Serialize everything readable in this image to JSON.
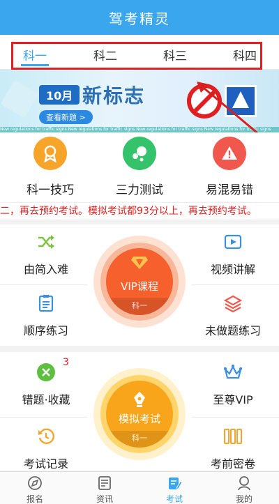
{
  "app": {
    "title": "驾考精灵"
  },
  "tabs": [
    {
      "label": "科一",
      "active": true
    },
    {
      "label": "科二",
      "active": false
    },
    {
      "label": "科三",
      "active": false
    },
    {
      "label": "科四",
      "active": false
    }
  ],
  "banner": {
    "month": "10月",
    "headline": "新标志",
    "button": "查看新题 >",
    "ticker": "New regulations for traffic signs      New regulations for traffic signs      New regulations for traffic signs      New regulations for traffic signs"
  },
  "features": [
    {
      "label": "科一技巧",
      "color": "#f7a52a",
      "icon": "medal-icon"
    },
    {
      "label": "三力测试",
      "color": "#34c26b",
      "icon": "bubbles-icon"
    },
    {
      "label": "易混易错",
      "color": "#f0584e",
      "icon": "warning-icon"
    }
  ],
  "marquee": "二，再去预约考试。模拟考试都93分以上，再去预约考试。",
  "section_a": {
    "left": [
      {
        "label": "由简入难",
        "icon": "shuffle-icon"
      },
      {
        "label": "顺序练习",
        "icon": "clipboard-icon"
      }
    ],
    "right": [
      {
        "label": "视频讲解",
        "icon": "video-icon"
      },
      {
        "label": "未做题练习",
        "icon": "layers-icon"
      }
    ],
    "center": {
      "label": "VIP课程",
      "sub": "科一"
    }
  },
  "section_b": {
    "left": [
      {
        "label": "错题·收藏",
        "icon": "close-circle-icon",
        "badge": "3"
      },
      {
        "label": "考试记录",
        "icon": "history-icon"
      }
    ],
    "right": [
      {
        "label": "至尊VIP",
        "icon": "crown-icon"
      },
      {
        "label": "考前密卷",
        "icon": "papers-icon"
      }
    ],
    "center": {
      "label": "模拟考试",
      "sub": "科一"
    }
  },
  "bottom_nav": [
    {
      "label": "报名",
      "icon": "signup-icon",
      "active": false
    },
    {
      "label": "资讯",
      "icon": "news-icon",
      "active": false
    },
    {
      "label": "考试",
      "icon": "exam-icon",
      "active": true
    },
    {
      "label": "我的",
      "icon": "profile-icon",
      "active": false
    }
  ],
  "colors": {
    "primary": "#3aa6ee",
    "alert": "#e02020"
  }
}
